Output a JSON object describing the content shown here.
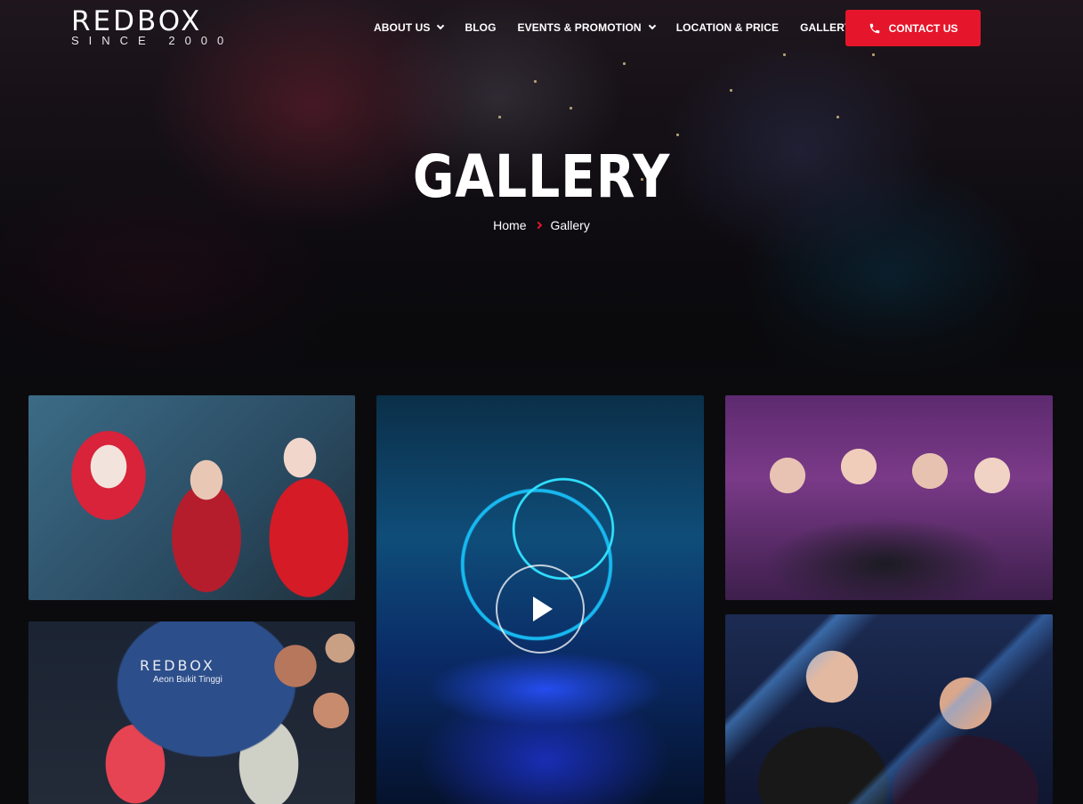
{
  "brand": {
    "logo_main": "REDBOX",
    "logo_sub": "SINCE 2000"
  },
  "nav": {
    "items": [
      {
        "label": "ABOUT US",
        "has_dropdown": true
      },
      {
        "label": "BLOG",
        "has_dropdown": false
      },
      {
        "label": "EVENTS & PROMOTION",
        "has_dropdown": true
      },
      {
        "label": "LOCATION & PRICE",
        "has_dropdown": false
      },
      {
        "label": "GALLERY",
        "has_dropdown": false
      }
    ],
    "contact_label": "CONTACT US",
    "contact_icon": "phone-icon"
  },
  "hero": {
    "title": "GALLERY",
    "breadcrumb": {
      "home": "Home",
      "current": "Gallery"
    }
  },
  "gallery": {
    "tiles": [
      {
        "caption": ""
      },
      {
        "caption": "",
        "video": true,
        "icon": "play-icon"
      },
      {
        "caption": ""
      },
      {
        "caption_main": "REDBOX",
        "caption_sub": "Aeon Bukit Tinggi"
      },
      {
        "caption": ""
      }
    ]
  },
  "colors": {
    "accent": "#e5162b",
    "background": "#0b0b0e"
  }
}
